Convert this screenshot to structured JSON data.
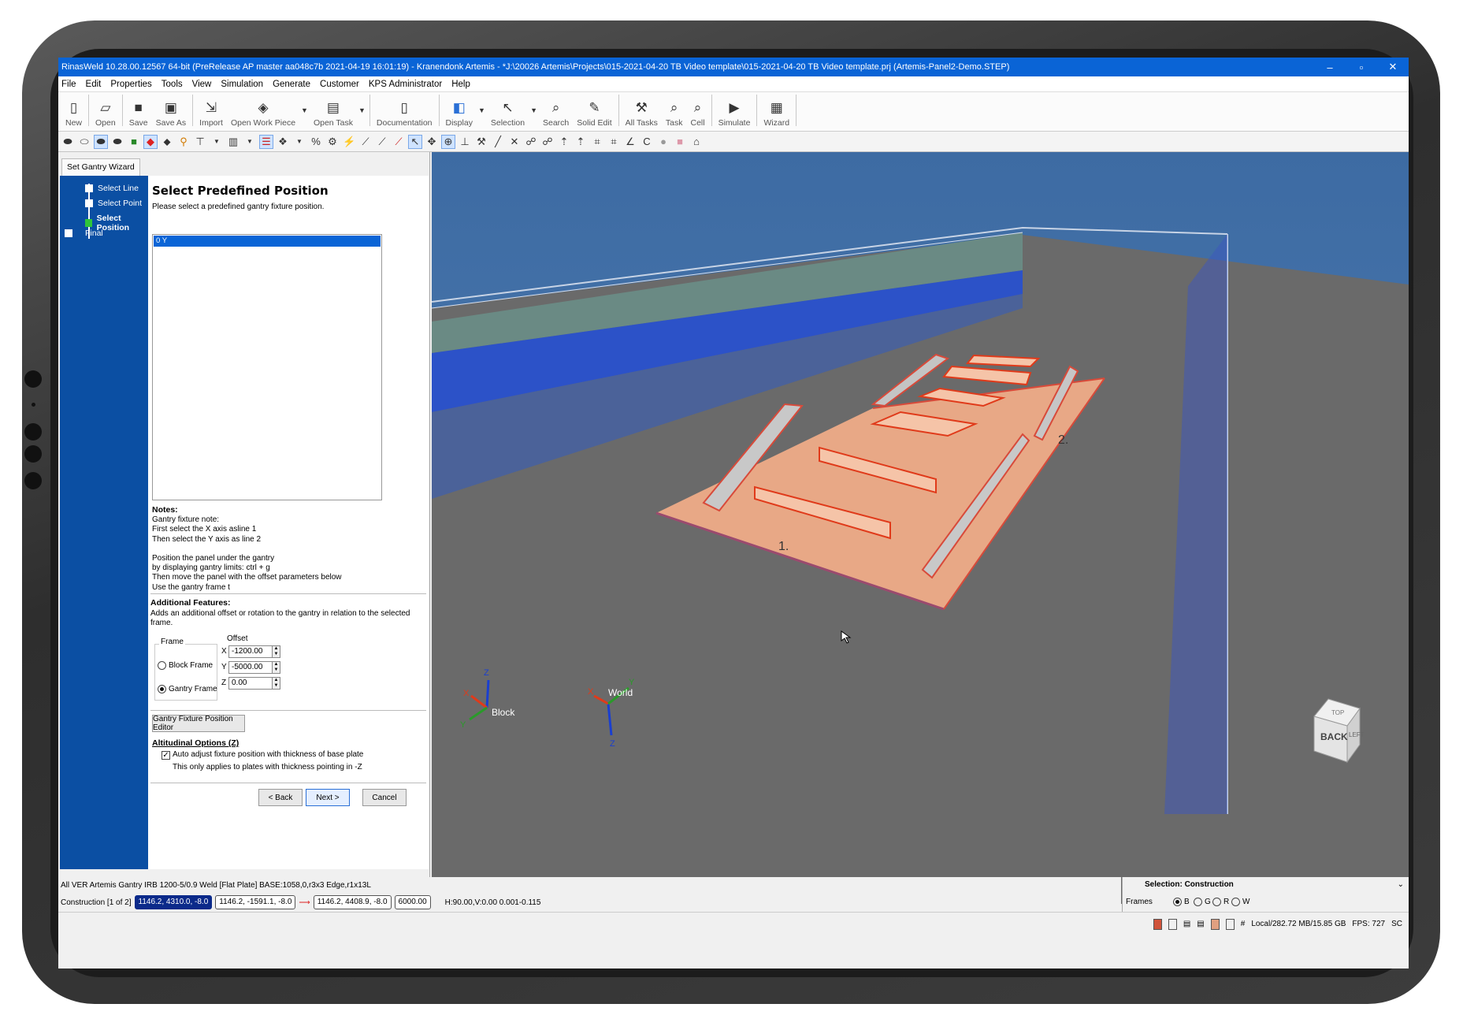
{
  "window": {
    "title": "RinasWeld 10.28.00.12567 64-bit (PreRelease AP master aa048c7b 2021-04-19 16:01:19) - Kranendonk Artemis - *J:\\20026 Artemis\\Projects\\015-2021-04-20 TB Video template\\015-2021-04-20 TB Video template.prj (Artemis-Panel2-Demo.STEP)",
    "minimize": "–",
    "restore": "▫",
    "close": "✕"
  },
  "menu": [
    "File",
    "Edit",
    "Properties",
    "Tools",
    "View",
    "Simulation",
    "Generate",
    "Customer",
    "KPS Administrator",
    "Help"
  ],
  "toolbar": {
    "new": "New",
    "open": "Open",
    "save": "Save",
    "save_as": "Save As",
    "import": "Import",
    "open_work_piece": "Open Work Piece",
    "open_task": "Open Task",
    "documentation": "Documentation",
    "display": "Display",
    "selection": "Selection",
    "search": "Search",
    "solid_edit": "Solid Edit",
    "all_tasks": "All Tasks",
    "task": "Task",
    "cell": "Cell",
    "simulate": "Simulate",
    "wizard": "Wizard"
  },
  "wizard": {
    "tab": "Set Gantry Wizard",
    "steps": [
      "Select Line",
      "Select Point",
      "Select Position",
      "Final"
    ],
    "title": "Select Predefined Position",
    "subtitle": "Please select a predefined gantry fixture position.",
    "list_items": [
      "0 Y"
    ],
    "notes_title": "Notes:",
    "notes_text": "Gantry fixture note:\nFirst select the X axis asline 1\nThen select the Y axis as line 2\n\nPosition the panel under the gantry\nby displaying gantry limits: ctrl + g\nThen move the panel with the offset parameters below\nUse the gantry frame t",
    "additional_title": "Additional Features:",
    "additional_text": "Adds an additional offset or rotation to the gantry in relation to the selected frame.",
    "frame_label": "Frame",
    "offset_label": "Offset",
    "block_frame": "Block Frame",
    "gantry_frame": "Gantry Frame",
    "x_label": "X",
    "y_label": "Y",
    "z_label": "Z",
    "x_value": "-1200.00",
    "y_value": "-5000.00",
    "z_value": "0.00",
    "position_editor": "Gantry Fixture Position Editor",
    "altitudinal_title": "Altitudinal Options (Z)",
    "auto_adjust": "Auto adjust fixture position with thickness of base plate",
    "auto_adjust_note": "This only applies to plates with thickness pointing in -Z",
    "back": "< Back",
    "next": "Next >",
    "cancel": "Cancel"
  },
  "viewport": {
    "label_1": "1.",
    "label_2": "2.",
    "block_label": "Block",
    "world_label": "World",
    "axis_x": "X",
    "axis_y": "Y",
    "axis_z": "Z",
    "cube_back": "BACK",
    "cube_left": "LEFT",
    "cube_top": "TOP"
  },
  "status": {
    "row1": "All  VER   Artemis Gantry   IRB 1200-5/0.9   Weld   [Flat Plate] BASE:1058,0,r3x3 Edge,r1x13L",
    "construction": "Construction [1 of 2]",
    "coord1": "1146.2, 4310.0, -8.0",
    "coord2": "1146.2, -1591.1, -8.0",
    "coord3": "1146.2, 4408.9, -8.0",
    "coord4": "6000.00",
    "hv": "H:90.00,V:0.00   0.001-0.115",
    "selection": "Selection: Construction",
    "frames": "Frames",
    "frame_b": "B",
    "frame_g": "G",
    "frame_r": "R",
    "frame_w": "W",
    "memory": "Local/282.72 MB/15.85 GB",
    "fps": "FPS: 727",
    "sc": "SC"
  },
  "colors": {
    "title_blue": "#0a64d6",
    "wizard_blue": "#0b4fa3",
    "step_current": "#2fc43a",
    "sky": "#3f6ea6",
    "floor": "#6b6b6b",
    "panel": "#e8a886",
    "weld_line": "#ff2a1a"
  }
}
